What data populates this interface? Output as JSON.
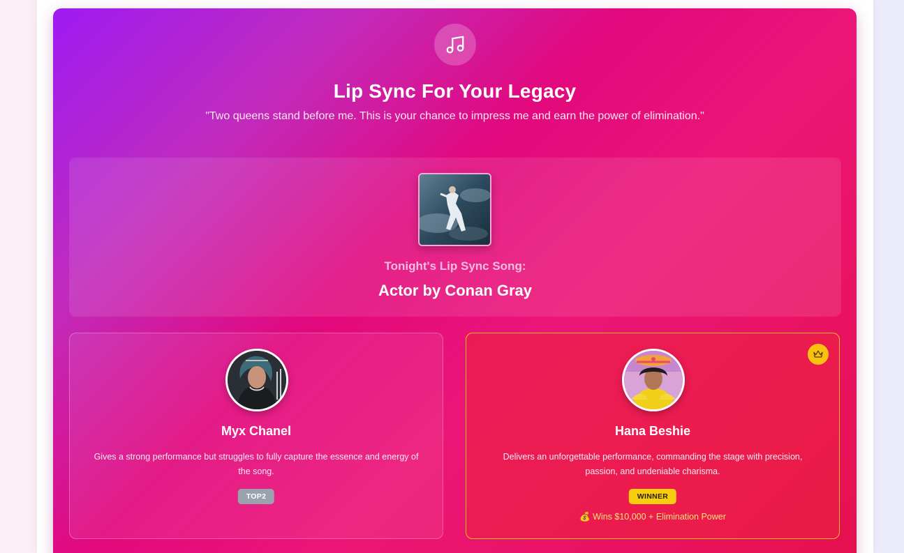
{
  "header": {
    "title": "Lip Sync For Your Legacy",
    "quote": "\"Two queens stand before me. This is your chance to impress me and earn the power of elimination.\""
  },
  "song": {
    "kicker": "Tonight's Lip Sync Song:",
    "name": "Actor by Conan Gray"
  },
  "queens": [
    {
      "name": "Myx Chanel",
      "description": "Gives a strong performance but struggles to fully capture the essence and energy of the song.",
      "badge": "TOP2"
    },
    {
      "name": "Hana Beshie",
      "description": "Delivers an unforgettable performance, commanding the stage with precision, passion, and undeniable charisma.",
      "badge": "WINNER",
      "prize": "💰 Wins $10,000 + Elimination Power"
    }
  ],
  "icons": {
    "header": "music-note-icon",
    "winner": "crown-icon"
  },
  "colors": {
    "gradient_start": "#9e1bf2",
    "gradient_mid": "#e2087d",
    "gradient_end": "#e6104d",
    "winner_gold": "#f8cd10",
    "top2_gray": "#9aa3ad"
  }
}
